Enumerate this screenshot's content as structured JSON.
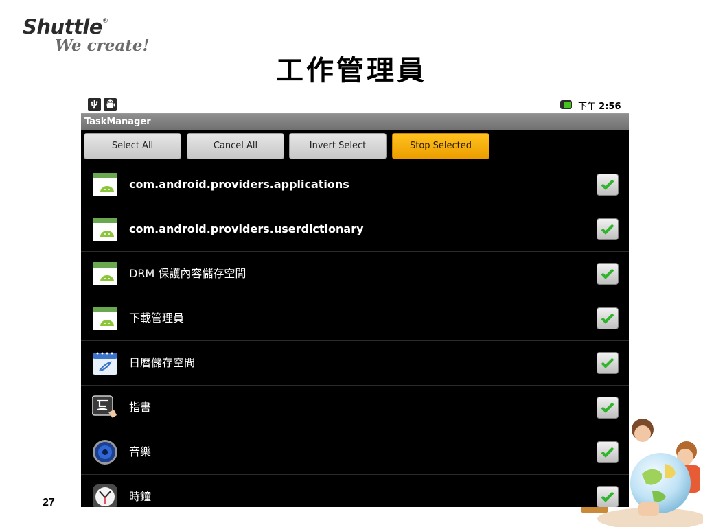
{
  "slide": {
    "logo_brand": "Shuttle",
    "logo_mark": "®",
    "logo_tagline": "We create!",
    "title": "工作管理員",
    "page_number": "27"
  },
  "status_bar": {
    "time_prefix": "下午",
    "time": "2:56",
    "left_icons": [
      "usb-icon",
      "android-debug-icon"
    ],
    "battery_color": "#46c21d"
  },
  "app": {
    "title": "TaskManager"
  },
  "toolbar": {
    "select_all": "Select All",
    "cancel_all": "Cancel All",
    "invert_select": "Invert Select",
    "stop_selected": "Stop Selected",
    "accent_color": "#f5a800"
  },
  "tasks": [
    {
      "label": "com.android.providers.applications",
      "icon": "android-app-icon",
      "checked": true
    },
    {
      "label": "com.android.providers.userdictionary",
      "icon": "android-app-icon",
      "checked": true
    },
    {
      "label": "DRM 保護內容儲存空間",
      "icon": "android-app-icon",
      "checked": true
    },
    {
      "label": "下載管理員",
      "icon": "android-app-icon",
      "checked": true
    },
    {
      "label": "日曆儲存空間",
      "icon": "calendar-icon",
      "checked": true
    },
    {
      "label": "指書",
      "icon": "handwriting-icon",
      "checked": true
    },
    {
      "label": "音樂",
      "icon": "music-speaker-icon",
      "checked": true
    },
    {
      "label": "時鐘",
      "icon": "clock-icon",
      "checked": true
    }
  ]
}
